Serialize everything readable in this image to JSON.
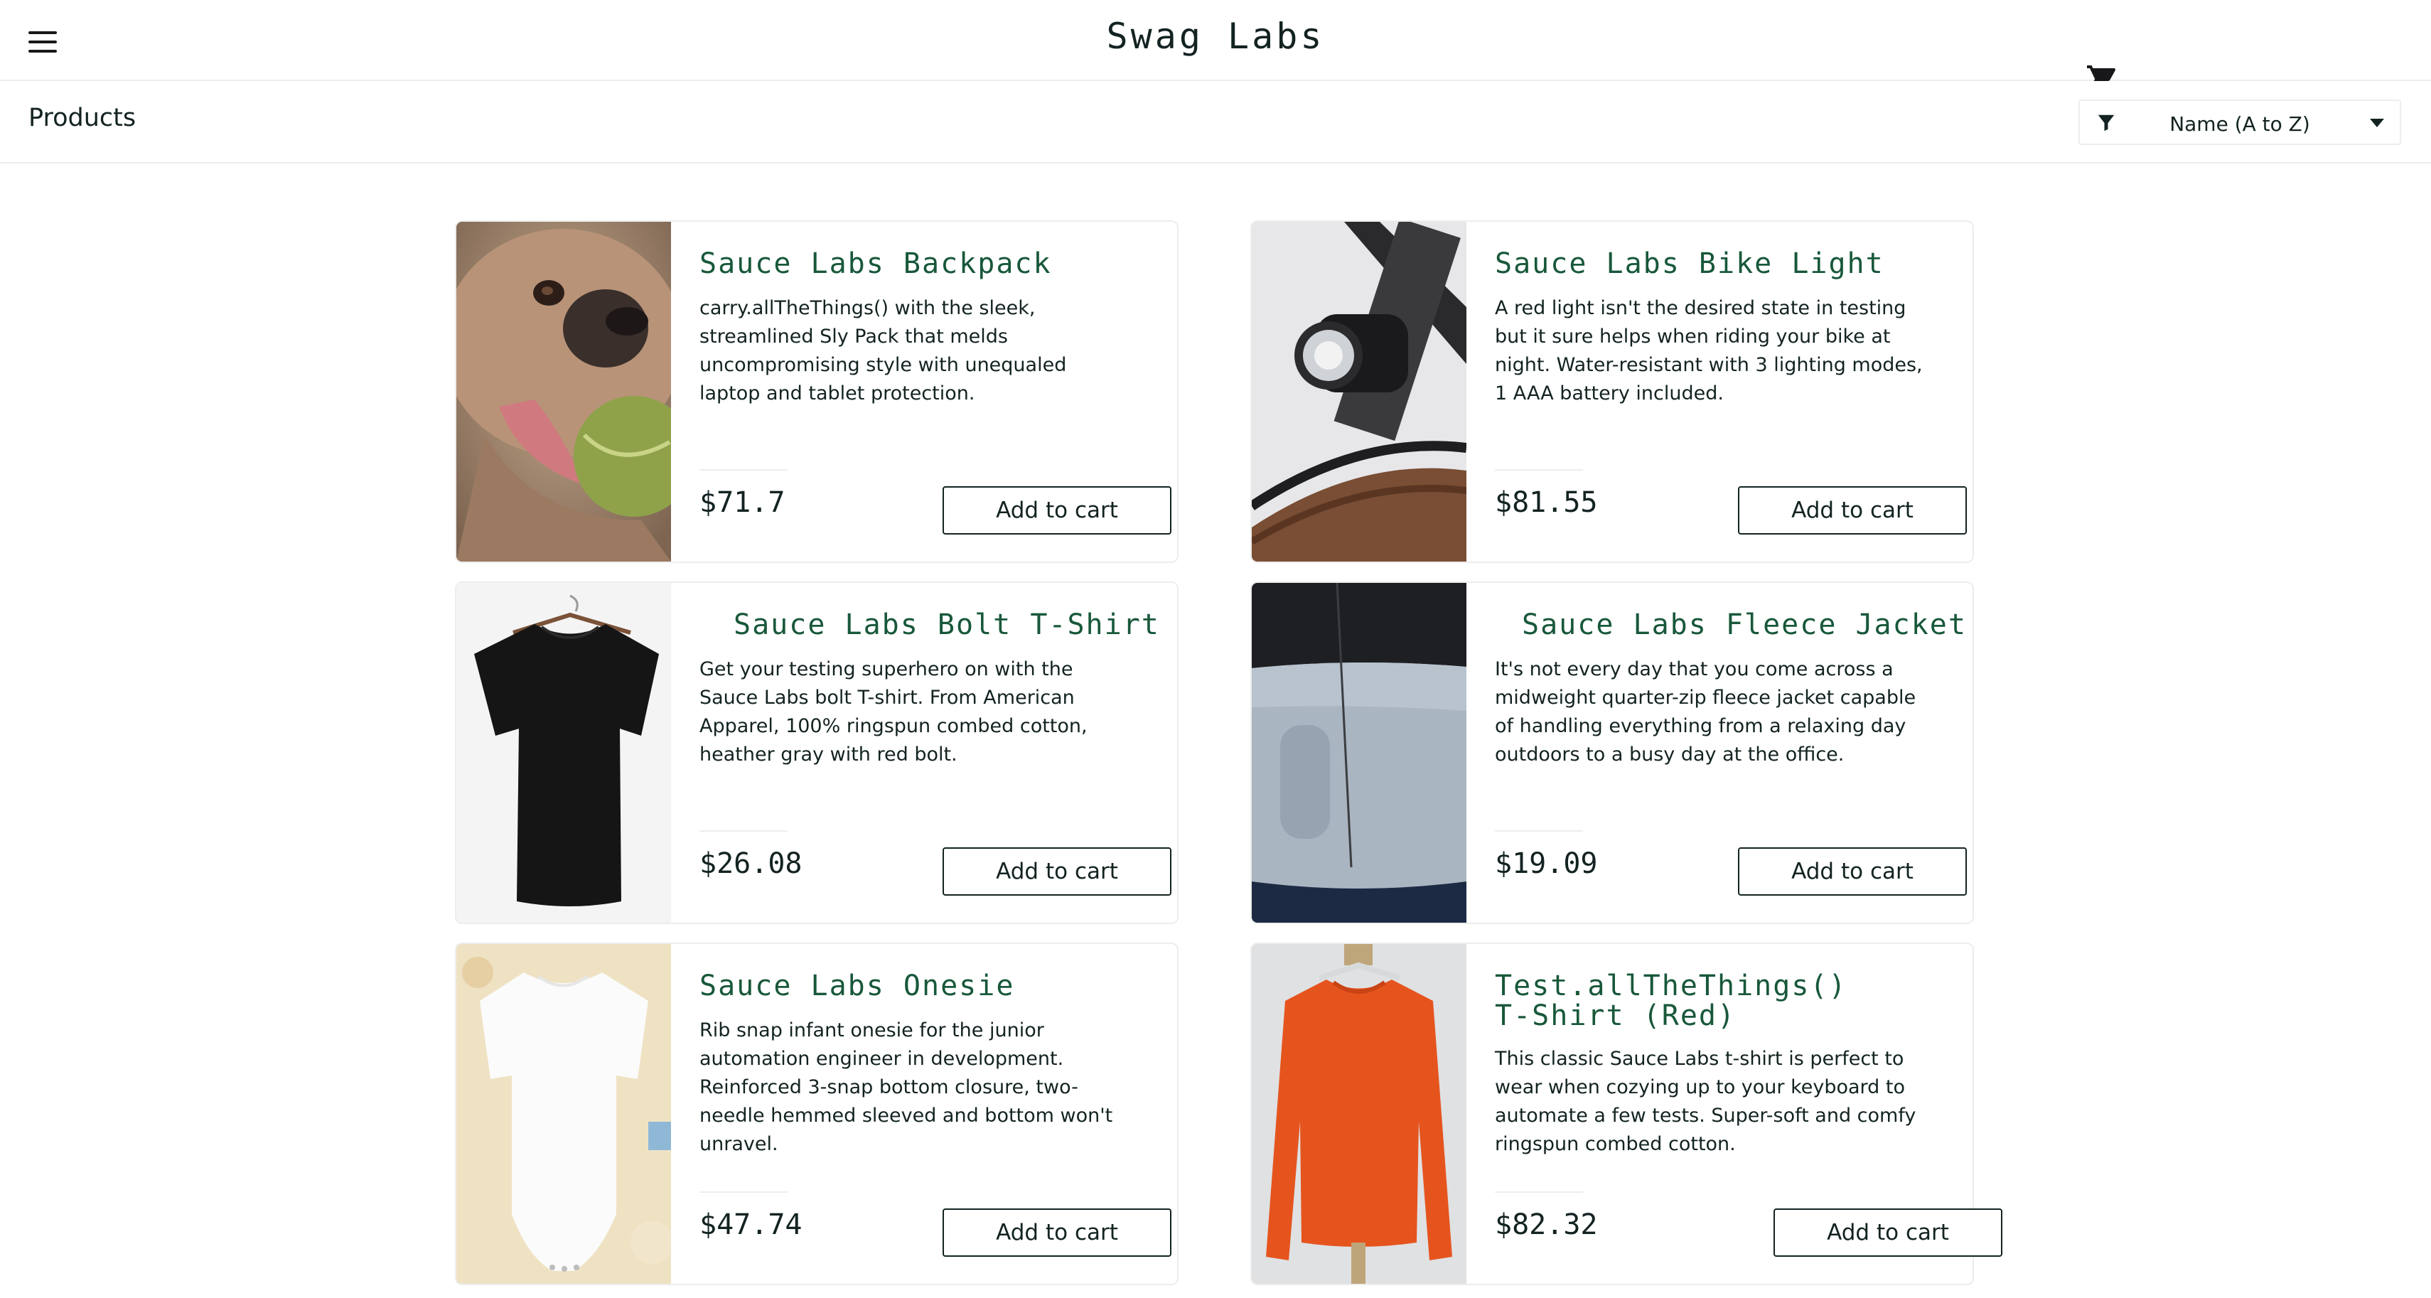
{
  "header": {
    "title": "Swag Labs",
    "menu_icon": "hamburger-menu-icon",
    "cart_icon": "shopping-cart-icon"
  },
  "subheader": {
    "title": "Products",
    "sort": {
      "icon": "filter-icon",
      "selected": "Name (A to Z)"
    }
  },
  "colors": {
    "product_name": "#18583a",
    "text": "#132322",
    "border": "#ededed"
  },
  "inventory": {
    "items": [
      {
        "name": "Sauce Labs Backpack",
        "description": "carry.allTheThings() with the sleek, streamlined Sly Pack that melds uncompromising style with unequaled laptop and tablet protection.",
        "price": "$71.7",
        "button": "Add to cart",
        "image": "pug-with-tennis-ball"
      },
      {
        "name": "Sauce Labs Bike Light",
        "description": "A red light isn't the desired state in testing but it sure helps when riding your bike at night. Water-resistant with 3 lighting modes, 1 AAA battery included.",
        "price": "$81.55",
        "button": "Add to cart",
        "image": "bike-light"
      },
      {
        "name": "Sauce Labs Bolt T-Shirt",
        "description": "Get your testing superhero on with the Sauce Labs bolt T-shirt. From American Apparel, 100% ringspun combed cotton, heather gray with red bolt.",
        "price": "$26.08",
        "button": "Add to cart",
        "image": "black-t-shirt"
      },
      {
        "name": "Sauce Labs Fleece Jacket",
        "description": "It's not every day that you come across a midweight quarter-zip fleece jacket capable of handling everything from a relaxing day outdoors to a busy day at the office.",
        "price": "$19.09",
        "button": "Add to cart",
        "image": "fleece-jacket"
      },
      {
        "name": "Sauce Labs Onesie",
        "description": "Rib snap infant onesie for the junior automation engineer in development. Reinforced 3-snap bottom closure, two-needle hemmed sleeved and bottom won't unravel.",
        "price": "$47.74",
        "button": "Add to cart",
        "image": "white-onesie"
      },
      {
        "name": "Test.allTheThings() T-Shirt (Red)",
        "description": "This classic Sauce Labs t-shirt is perfect to wear when cozying up to your keyboard to automate a few tests. Super-soft and comfy ringspun combed cotton.",
        "price": "$82.32",
        "button": "Add to cart",
        "image": "red-sweatshirt"
      }
    ]
  }
}
